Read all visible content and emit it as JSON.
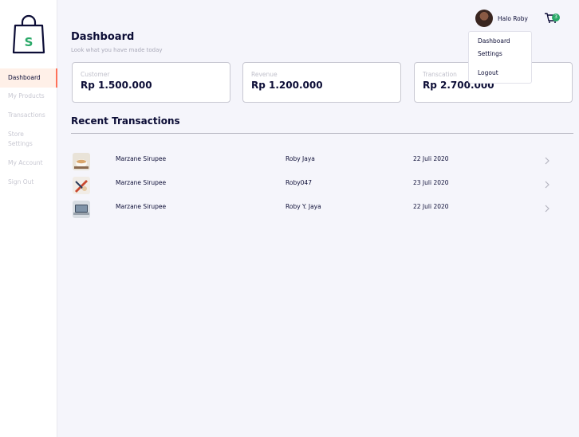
{
  "sidebar": {
    "logo_letter": "S",
    "items": [
      {
        "label": "Dashboard"
      },
      {
        "label": "My Products"
      },
      {
        "label": "Transactions"
      },
      {
        "label": "Store Settings"
      },
      {
        "label": "My Account"
      },
      {
        "label": "Sign Out"
      }
    ]
  },
  "header": {
    "greeting": "Halo Roby",
    "cart_count": "3"
  },
  "dropdown": {
    "items": [
      {
        "label": "Dashboard"
      },
      {
        "label": "Settings"
      },
      {
        "label": "Logout"
      }
    ]
  },
  "page": {
    "title": "Dashboard",
    "subtitle": "Look what you have made today"
  },
  "cards": [
    {
      "label": "Customer",
      "value": "Rp 1.500.000"
    },
    {
      "label": "Revenue",
      "value": "Rp 1.200.000"
    },
    {
      "label": "Transcation",
      "value": "Rp 2.700.000"
    }
  ],
  "transactions": {
    "title": "Recent Transactions",
    "rows": [
      {
        "product": "Marzane Sirupee",
        "buyer": "Roby Jaya",
        "date": "22 Juli 2020"
      },
      {
        "product": "Marzane Sirupee",
        "buyer": "Roby047",
        "date": "23 Juli 2020"
      },
      {
        "product": "Marzane Sirupee",
        "buyer": "Roby Y. Jaya",
        "date": "22 Juli 2020"
      }
    ]
  },
  "colors": {
    "accent": "#ff7158",
    "brand_green": "#29a867",
    "text": "#0c0d36",
    "muted": "#c8c8d2",
    "background": "#f5f5fb"
  }
}
